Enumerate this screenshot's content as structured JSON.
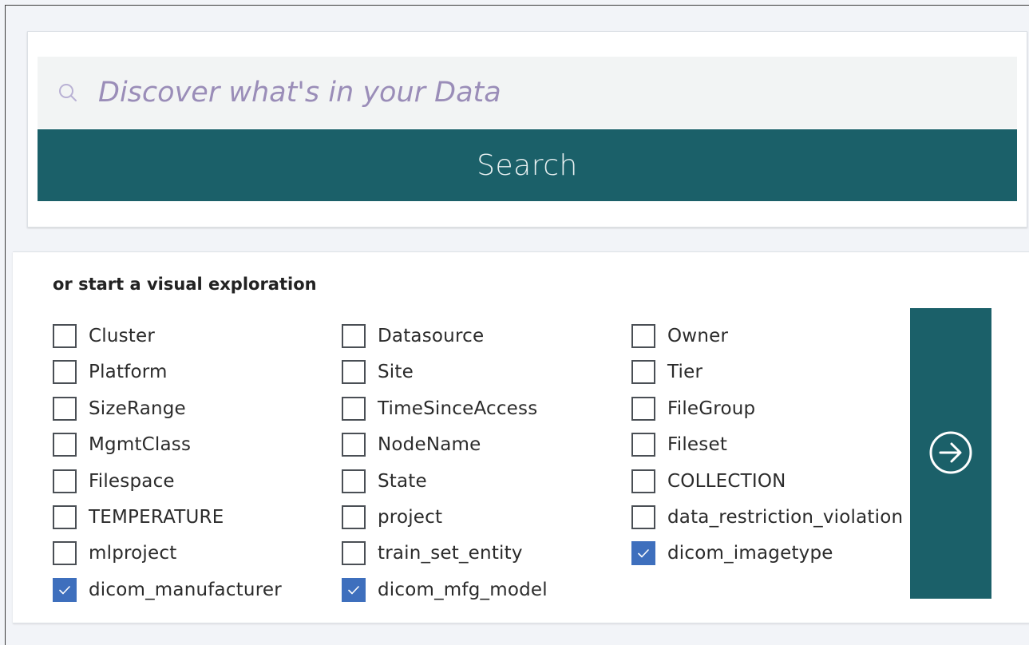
{
  "search": {
    "placeholder": "Discover what's in your Data",
    "button_label": "Search"
  },
  "exploration": {
    "title": "or start a visual exploration",
    "columns": [
      [
        {
          "label": "Cluster",
          "checked": false
        },
        {
          "label": "Platform",
          "checked": false
        },
        {
          "label": "SizeRange",
          "checked": false
        },
        {
          "label": "MgmtClass",
          "checked": false
        },
        {
          "label": "Filespace",
          "checked": false
        },
        {
          "label": "TEMPERATURE",
          "checked": false
        },
        {
          "label": "mlproject",
          "checked": false
        },
        {
          "label": "dicom_manufacturer",
          "checked": true
        }
      ],
      [
        {
          "label": "Datasource",
          "checked": false
        },
        {
          "label": "Site",
          "checked": false
        },
        {
          "label": "TimeSinceAccess",
          "checked": false
        },
        {
          "label": "NodeName",
          "checked": false
        },
        {
          "label": "State",
          "checked": false
        },
        {
          "label": "project",
          "checked": false
        },
        {
          "label": "train_set_entity",
          "checked": false
        },
        {
          "label": "dicom_mfg_model",
          "checked": true
        }
      ],
      [
        {
          "label": "Owner",
          "checked": false
        },
        {
          "label": "Tier",
          "checked": false
        },
        {
          "label": "FileGroup",
          "checked": false
        },
        {
          "label": "Fileset",
          "checked": false
        },
        {
          "label": "COLLECTION",
          "checked": false
        },
        {
          "label": "data_restriction_violation",
          "checked": false
        },
        {
          "label": "dicom_imagetype",
          "checked": true
        }
      ]
    ],
    "go_icon": "arrow-right-circle-icon"
  },
  "colors": {
    "primary": "#1b6069",
    "checkbox_checked": "#3e6fbd",
    "placeholder": "#9a8db8"
  }
}
